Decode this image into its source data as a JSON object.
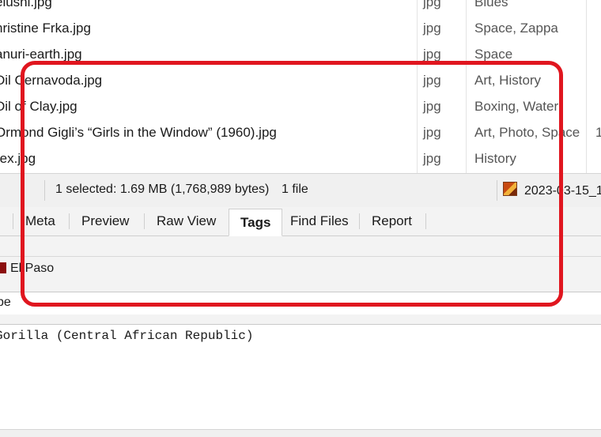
{
  "files": [
    {
      "name": "elushi.jpg",
      "ext": "jpg",
      "tags": "Blues",
      "extra": ""
    },
    {
      "name": "hristine Frka.jpg",
      "ext": "jpg",
      "tags": "Space, Zappa",
      "extra": ""
    },
    {
      "name": "anuri-earth.jpg",
      "ext": "jpg",
      "tags": "Space",
      "extra": ""
    },
    {
      "name": "Dil Cernavoda.jpg",
      "ext": "jpg",
      "tags": "Art, History",
      "extra": ""
    },
    {
      "name": "Dil of Clay.jpg",
      "ext": "jpg",
      "tags": "Boxing, Water",
      "extra": ""
    },
    {
      "name": "Ormond Gigli’s “Girls in the Window” (1960).jpg",
      "ext": "jpg",
      "tags": "Art, Photo, Space",
      "extra": "1"
    },
    {
      "name": "rex.jpg",
      "ext": "jpg",
      "tags": "History",
      "extra": ""
    }
  ],
  "status": {
    "selection": "1 selected: 1.69 MB (1,768,989 bytes)",
    "count": "1 file",
    "date": "2023-03-15_1"
  },
  "tabs": [
    {
      "label": "Meta"
    },
    {
      "label": "Preview"
    },
    {
      "label": "Raw View"
    },
    {
      "label": "Tags"
    },
    {
      "label": "Find Files"
    },
    {
      "label": "Report"
    }
  ],
  "active_tab": "Tags",
  "tag_panel": {
    "chip_label": "El Paso",
    "chip_color": "#8b0d0d"
  },
  "search": {
    "value": "pe"
  },
  "text_area": {
    "content": "Gorilla (Central African Republic)"
  },
  "highlight_color": "#e0161f"
}
